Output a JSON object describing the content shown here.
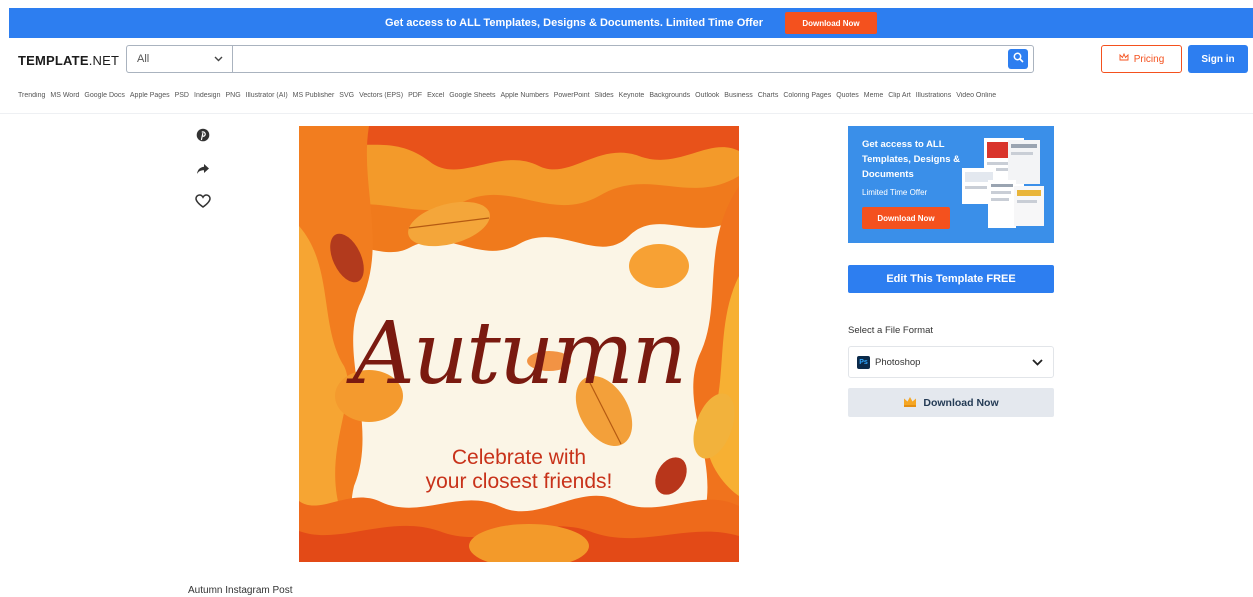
{
  "promo_banner": {
    "text": "Get access to ALL Templates, Designs & Documents. Limited Time Offer",
    "button_label": "Download Now",
    "color": "#2d7ef0"
  },
  "header": {
    "logo_bold": "TEMPLATE",
    "logo_thin": ".NET",
    "search_category": "All",
    "search_placeholder": "",
    "pricing_label": "Pricing",
    "signin_label": "Sign in"
  },
  "categories": [
    "Trending",
    "MS Word",
    "Google Docs",
    "Apple Pages",
    "PSD",
    "Indesign",
    "PNG",
    "Illustrator (AI)",
    "MS Publisher",
    "SVG",
    "Vectors (EPS)",
    "PDF",
    "Excel",
    "Google Sheets",
    "Apple Numbers",
    "PowerPoint",
    "Slides",
    "Keynote",
    "Backgrounds",
    "Outlook",
    "Business",
    "Charts",
    "Coloring Pages",
    "Quotes",
    "Meme",
    "Clip Art",
    "Illustrations",
    "Video Online"
  ],
  "share_icons": [
    "pinterest-icon",
    "share-icon",
    "heart-icon"
  ],
  "artwork": {
    "title": "Autumn",
    "subtitle_line1": "Celebrate with",
    "subtitle_line2": "your closest friends!"
  },
  "caption": "Autumn Instagram Post",
  "sidebar": {
    "promo_heading": "Get access to ALL Templates, Designs & Documents",
    "promo_sub": "Limited Time Offer",
    "promo_button": "Download Now",
    "edit_button": "Edit This Template FREE",
    "format_label": "Select a File Format",
    "format_value": "Photoshop",
    "format_icon_text": "Ps",
    "download_button": "Download Now"
  },
  "colors": {
    "accent_blue": "#2d7ef0",
    "accent_orange": "#f4511e"
  }
}
